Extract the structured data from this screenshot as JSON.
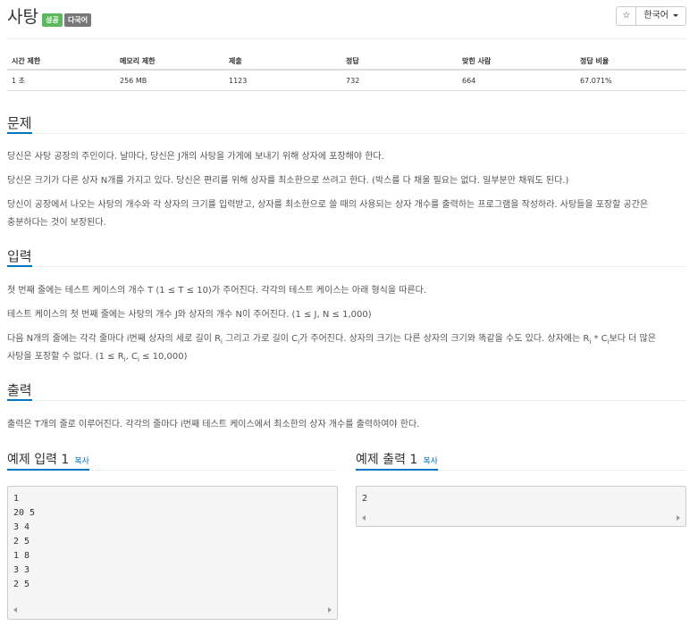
{
  "problem": {
    "title": "사탕",
    "badge_success": "성공",
    "badge_multilang": "다국어"
  },
  "toolbar": {
    "star": "☆",
    "language": "한국어"
  },
  "info_table": {
    "headers": [
      "시간 제한",
      "메모리 제한",
      "제출",
      "정답",
      "맞힌 사람",
      "정답 비율"
    ],
    "values": [
      "1 초",
      "256 MB",
      "1123",
      "732",
      "664",
      "67.071%"
    ]
  },
  "sections": {
    "problem_heading": "문제",
    "problem_p1": "당신은 사탕 공장의 주인이다. 날마다, 당신은 J개의 사탕을 가게에 보내기 위해 상자에 포장해야 한다.",
    "problem_p2": "당신은 크기가 다른 상자 N개를 가지고 있다. 당신은 편리를 위해 상자를 최소한으로 쓰려고 한다. (박스를 다 채울 필요는 없다. 일부분만 채워도 된다.)",
    "problem_p3a": "당신이 공장에서 나오는 사탕의 개수와 각 상자의 크기를 입력받고, 상자를 최소한으로 쓸 때의 사용되는 상자 개수를 출력하는 프로그램을 작성하라. 사탕들을 포장할 공간은",
    "problem_p3b": "충분하다는 것이 보장된다.",
    "input_heading": "입력",
    "input_p1": "첫 번째 줄에는 테스트 케이스의 개수 T (1 ≤ T ≤ 10)가 주어진다. 각각의 테스트 케이스는 아래 형식을 따른다.",
    "input_p2": "테스트 케이스의 첫 번째 줄에는 사탕의 개수 J와 상자의 개수 N이 주어진다. (1 ≤ J, N ≤ 1,000)",
    "input_p3a_1": "다음 N개의 줄에는 각각 줄마다 i번째 상자의 세로 길이 R",
    "input_p3a_2": " 그리고 가로 길이 C",
    "input_p3a_3": "가 주어진다. 상자의 크기는 다른 상자의 크기와 똑같을 수도 있다. 상자에는 R",
    "input_p3a_4": " * C",
    "input_p3a_5": "보다 더 많은",
    "input_p3b_1": "사탕을 포장할 수 없다. (1 ≤ R",
    "input_p3b_2": ", C",
    "input_p3b_3": " ≤ 10,000)",
    "sub_i": "i",
    "output_heading": "출력",
    "output_p1": "출력은 T개의 줄로 이루어진다. 각각의 줄마다 i번째 테스트 케이스에서 최소한의 상자 개수를 출력하여야 한다."
  },
  "samples": {
    "input_heading": "예제 입력 1",
    "output_heading": "예제 출력 1",
    "copy_label": "복사",
    "input_lines": [
      "1",
      "20 5",
      "3 4",
      "2 5",
      "1 8",
      "3 3",
      "2 5"
    ],
    "output_lines": [
      "2"
    ]
  }
}
